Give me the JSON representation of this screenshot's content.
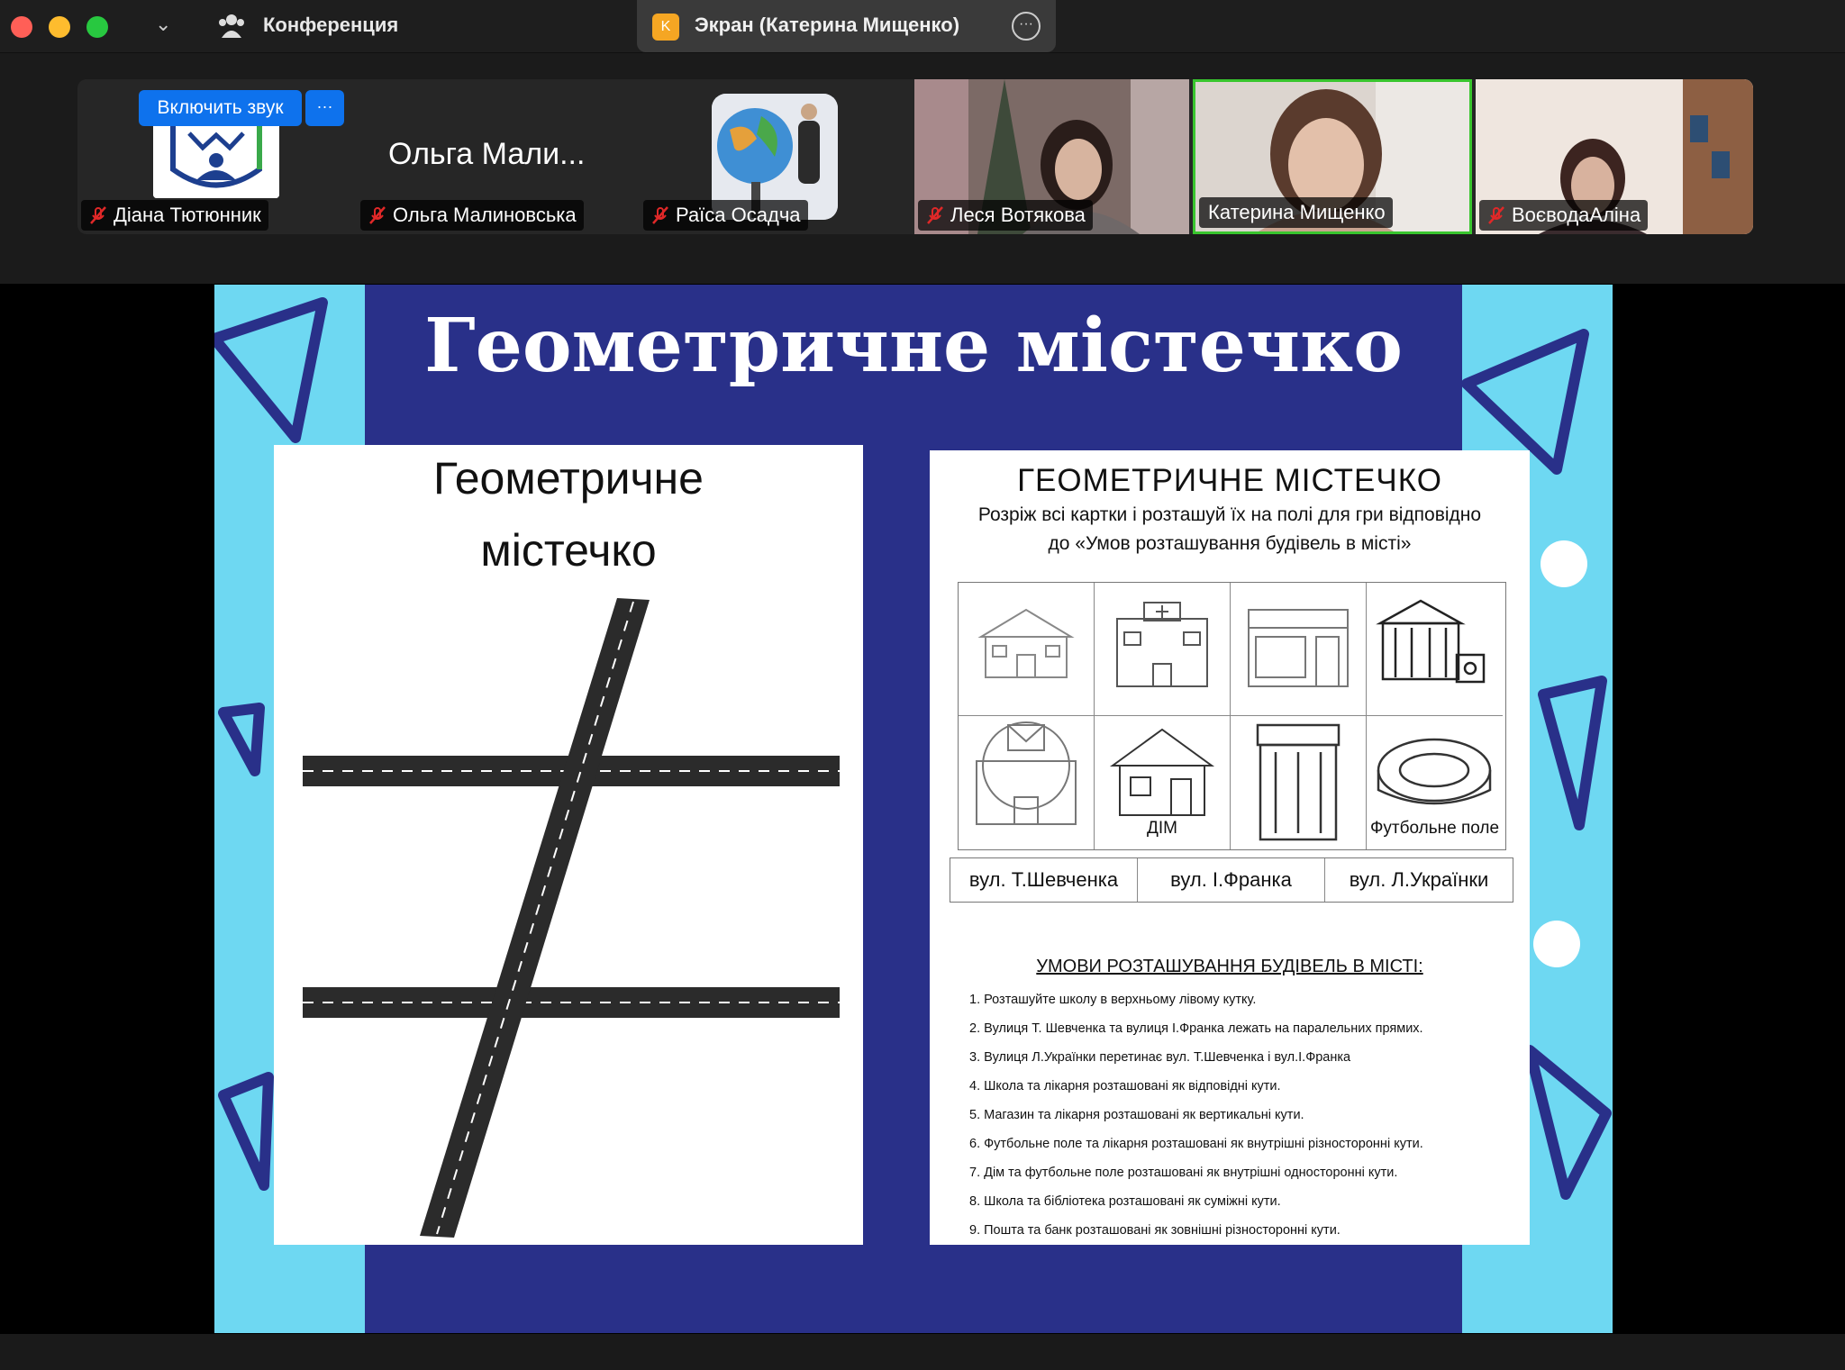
{
  "titlebar": {
    "conference_label": "Конференция",
    "share_badge": "K",
    "share_label": "Экран (Катерина Мищенко)"
  },
  "participants": {
    "unmute_button": "Включить звук",
    "unmute_more": "···",
    "tiles": [
      {
        "name": "Діана Тютюнник"
      },
      {
        "name": "Ольга Малиновська",
        "big_name": "Ольга Мали..."
      },
      {
        "name": "Раїса Осадча"
      },
      {
        "name": "Леся Вотякова"
      },
      {
        "name": "Катерина Мищенко"
      },
      {
        "name": "ВоєводаАліна"
      }
    ]
  },
  "slide": {
    "title": "Геометричне містечко",
    "left_card": {
      "title_line1": "Геометричне",
      "title_line2": "містечко"
    },
    "right_card": {
      "title": "ГЕОМЕТРИЧНЕ МІСТЕЧКО",
      "subtitle_line1": "Розріж всі картки і розташуй їх на полі для гри відповідно",
      "subtitle_line2": "до «Умов розташування будівель в місті»",
      "grid_labels": [
        "",
        "",
        "",
        "",
        "",
        "ДІМ",
        "",
        "Футбольне поле"
      ],
      "streets": [
        "вул. Т.Шевченка",
        "вул. І.Франка",
        "вул. Л.Українки"
      ],
      "conditions_heading": "УМОВИ РОЗТАШУВАННЯ БУДІВЕЛЬ В МІСТІ:",
      "conditions": [
        "1. Розташуйте школу в верхньому лівому кутку.",
        "2. Вулиця Т. Шевченка та вулиця І.Франка лежать на паралельних прямих.",
        "3. Вулиця Л.Українки перетинає вул. Т.Шевченка і вул.І.Франка",
        "4. Школа та лікарня розташовані як відповідні кути.",
        "5. Магазин та лікарня розташовані як вертикальні кути.",
        "6. Футбольне поле та лікарня розташовані як внутрішні різносторонні кути.",
        "7. Дім та футбольне поле розташовані як внутрішні односторонні кути.",
        "8. Школа та бібліотека розташовані як суміжні кути.",
        "9. Пошта та банк розташовані як зовнішні різносторонні кути."
      ]
    }
  },
  "colors": {
    "slide_blue": "#293089",
    "slide_cyan": "#6ed8f2",
    "active_speaker": "#39c52e",
    "zoom_blue": "#0e72ed"
  }
}
